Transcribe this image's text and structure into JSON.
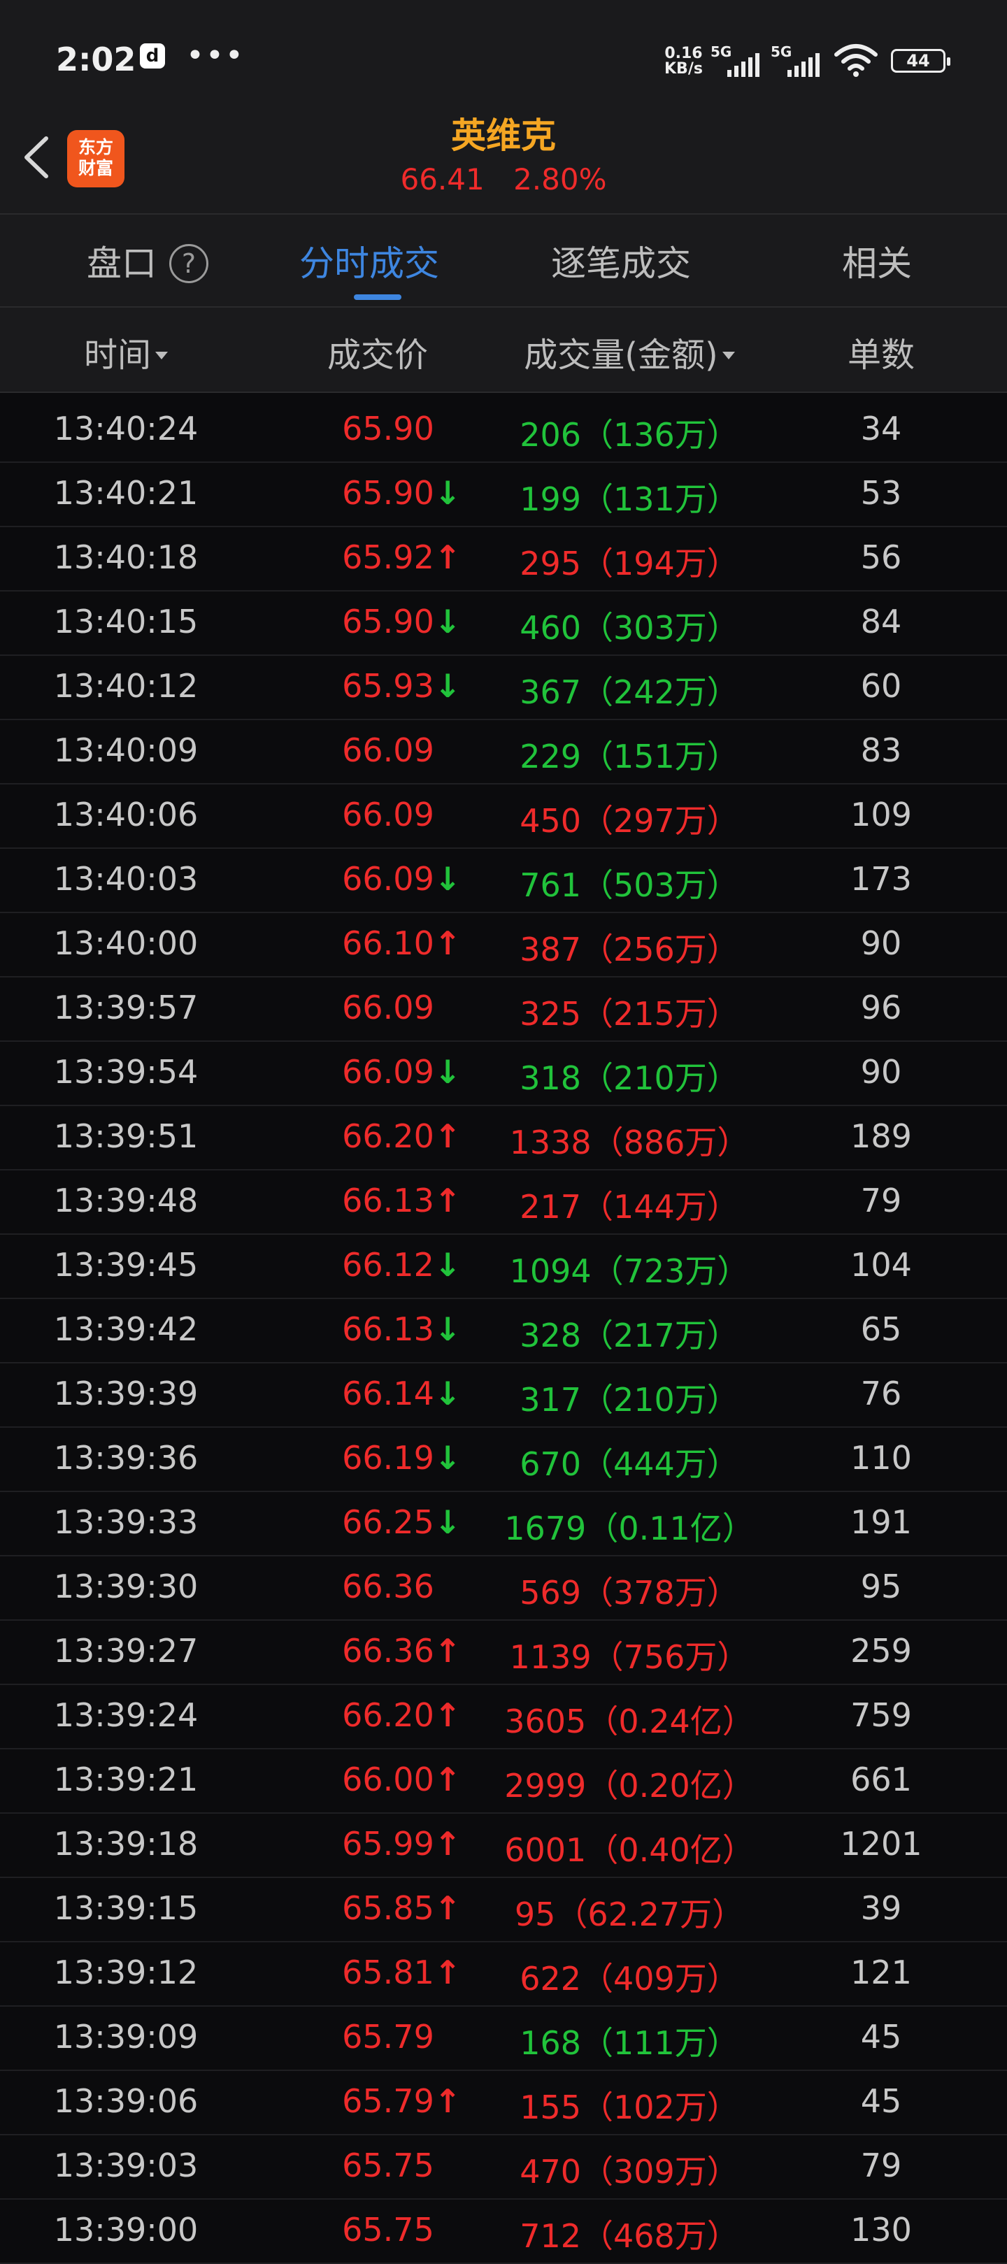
{
  "status_bar": {
    "time": "2:02",
    "app_badge": "d",
    "more": "•••",
    "speed_top": "0.16",
    "speed_bottom": "KB/s",
    "sim1": "5G",
    "sim2": "5G",
    "battery": "44"
  },
  "header": {
    "logo_line1": "东方",
    "logo_line2": "财富",
    "title": "英维克",
    "price": "66.41",
    "change": "2.80%"
  },
  "tabs": [
    {
      "label": "盘口",
      "active": false
    },
    {
      "label": "分时成交",
      "active": true
    },
    {
      "label": "逐笔成交",
      "active": false
    },
    {
      "label": "相关",
      "active": false
    }
  ],
  "help_icon_glyph": "?",
  "columns": {
    "time": "时间",
    "price": "成交价",
    "volume": "成交量(金额)",
    "count": "单数"
  },
  "colors": {
    "red": "#ef2b2b",
    "green": "#21c33b",
    "accent": "#3e86e0",
    "title": "#f5a623"
  },
  "rows": [
    {
      "time": "13:40:24",
      "price": "65.90",
      "arrow": "",
      "vol": "206（136万）",
      "vol_color": "green",
      "count": "34"
    },
    {
      "time": "13:40:21",
      "price": "65.90",
      "arrow": "down",
      "vol": "199（131万）",
      "vol_color": "green",
      "count": "53"
    },
    {
      "time": "13:40:18",
      "price": "65.92",
      "arrow": "up",
      "vol": "295（194万）",
      "vol_color": "red",
      "count": "56"
    },
    {
      "time": "13:40:15",
      "price": "65.90",
      "arrow": "down",
      "vol": "460（303万）",
      "vol_color": "green",
      "count": "84"
    },
    {
      "time": "13:40:12",
      "price": "65.93",
      "arrow": "down",
      "vol": "367（242万）",
      "vol_color": "green",
      "count": "60"
    },
    {
      "time": "13:40:09",
      "price": "66.09",
      "arrow": "",
      "vol": "229（151万）",
      "vol_color": "green",
      "count": "83"
    },
    {
      "time": "13:40:06",
      "price": "66.09",
      "arrow": "",
      "vol": "450（297万）",
      "vol_color": "red",
      "count": "109"
    },
    {
      "time": "13:40:03",
      "price": "66.09",
      "arrow": "down",
      "vol": "761（503万）",
      "vol_color": "green",
      "count": "173"
    },
    {
      "time": "13:40:00",
      "price": "66.10",
      "arrow": "up",
      "vol": "387（256万）",
      "vol_color": "red",
      "count": "90"
    },
    {
      "time": "13:39:57",
      "price": "66.09",
      "arrow": "",
      "vol": "325（215万）",
      "vol_color": "red",
      "count": "96"
    },
    {
      "time": "13:39:54",
      "price": "66.09",
      "arrow": "down",
      "vol": "318（210万）",
      "vol_color": "green",
      "count": "90"
    },
    {
      "time": "13:39:51",
      "price": "66.20",
      "arrow": "up",
      "vol": "1338（886万）",
      "vol_color": "red",
      "count": "189"
    },
    {
      "time": "13:39:48",
      "price": "66.13",
      "arrow": "up",
      "vol": "217（144万）",
      "vol_color": "red",
      "count": "79"
    },
    {
      "time": "13:39:45",
      "price": "66.12",
      "arrow": "down",
      "vol": "1094（723万）",
      "vol_color": "green",
      "count": "104"
    },
    {
      "time": "13:39:42",
      "price": "66.13",
      "arrow": "down",
      "vol": "328（217万）",
      "vol_color": "green",
      "count": "65"
    },
    {
      "time": "13:39:39",
      "price": "66.14",
      "arrow": "down",
      "vol": "317（210万）",
      "vol_color": "green",
      "count": "76"
    },
    {
      "time": "13:39:36",
      "price": "66.19",
      "arrow": "down",
      "vol": "670（444万）",
      "vol_color": "green",
      "count": "110"
    },
    {
      "time": "13:39:33",
      "price": "66.25",
      "arrow": "down",
      "vol": "1679（0.11亿）",
      "vol_color": "green",
      "count": "191"
    },
    {
      "time": "13:39:30",
      "price": "66.36",
      "arrow": "",
      "vol": "569（378万）",
      "vol_color": "red",
      "count": "95"
    },
    {
      "time": "13:39:27",
      "price": "66.36",
      "arrow": "up",
      "vol": "1139（756万）",
      "vol_color": "red",
      "count": "259"
    },
    {
      "time": "13:39:24",
      "price": "66.20",
      "arrow": "up",
      "vol": "3605（0.24亿）",
      "vol_color": "red",
      "count": "759"
    },
    {
      "time": "13:39:21",
      "price": "66.00",
      "arrow": "up",
      "vol": "2999（0.20亿）",
      "vol_color": "red",
      "count": "661"
    },
    {
      "time": "13:39:18",
      "price": "65.99",
      "arrow": "up",
      "vol": "6001（0.40亿）",
      "vol_color": "red",
      "count": "1201"
    },
    {
      "time": "13:39:15",
      "price": "65.85",
      "arrow": "up",
      "vol": "95（62.27万）",
      "vol_color": "red",
      "count": "39"
    },
    {
      "time": "13:39:12",
      "price": "65.81",
      "arrow": "up",
      "vol": "622（409万）",
      "vol_color": "red",
      "count": "121"
    },
    {
      "time": "13:39:09",
      "price": "65.79",
      "arrow": "",
      "vol": "168（111万）",
      "vol_color": "green",
      "count": "45"
    },
    {
      "time": "13:39:06",
      "price": "65.79",
      "arrow": "up",
      "vol": "155（102万）",
      "vol_color": "red",
      "count": "45"
    },
    {
      "time": "13:39:03",
      "price": "65.75",
      "arrow": "",
      "vol": "470（309万）",
      "vol_color": "red",
      "count": "79"
    },
    {
      "time": "13:39:00",
      "price": "65.75",
      "arrow": "",
      "vol": "712（468万）",
      "vol_color": "red",
      "count": "130"
    }
  ]
}
